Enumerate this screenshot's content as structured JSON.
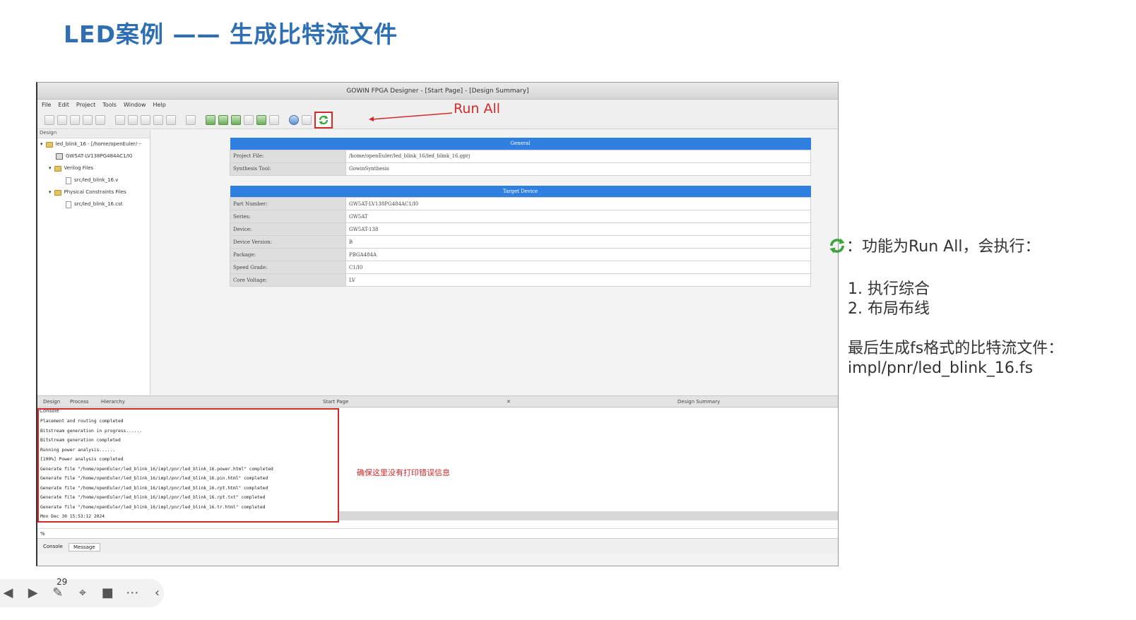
{
  "slide": {
    "title": "LED案例 —— 生成比特流文件"
  },
  "window": {
    "title": "GOWIN FPGA Designer - [Start Page] - [Design Summary]",
    "menu": [
      "File",
      "Edit",
      "Project",
      "Tools",
      "Window",
      "Help"
    ],
    "annotation_label": "Run All"
  },
  "design_panel": {
    "header": "Design",
    "tree": [
      "led_blink_16 - [/home/openEuler/···",
      "GW5AT-LV138PG484AC1/I0",
      "Verilog Files",
      "src/led_blink_16.v",
      "Physical Constraints Files",
      "src/led_blink_16.cst"
    ]
  },
  "summary": {
    "general_header": "General",
    "general_rows": [
      {
        "key": "Project File:",
        "value": "/home/openEuler/led_blink_16/led_blink_16.gprj"
      },
      {
        "key": "Synthesis Tool:",
        "value": "GowinSynthesis"
      }
    ],
    "device_header": "Target Device",
    "device_rows": [
      {
        "key": "Part Number:",
        "value": "GW5AT-LV138PG484AC1/I0"
      },
      {
        "key": "Series:",
        "value": "GW5AT"
      },
      {
        "key": "Device:",
        "value": "GW5AT-138"
      },
      {
        "key": "Device Version:",
        "value": "B"
      },
      {
        "key": "Package:",
        "value": "PBGA484A"
      },
      {
        "key": "Speed Grade:",
        "value": "C1/I0"
      },
      {
        "key": "Core Voltage:",
        "value": "LV"
      }
    ]
  },
  "tabs": {
    "design": "Design",
    "process": "Process",
    "hierarchy": "Hierarchy",
    "start_page": "Start Page",
    "close": "✕",
    "design_summary": "Design Summary"
  },
  "console": {
    "header": "Console",
    "lines": [
      "Placement and routing completed",
      "Bitstream generation in progress......",
      "Bitstream generation completed",
      "Running power analysis......",
      "[100%] Power analysis completed",
      "Generate file \"/home/openEuler/led_blink_16/impl/pnr/led_blink_16.power.html\" completed",
      "Generate file \"/home/openEuler/led_blink_16/impl/pnr/led_blink_16.pin.html\" completed",
      "Generate file \"/home/openEuler/led_blink_16/impl/pnr/led_blink_16.rpt.html\" completed",
      "Generate file \"/home/openEuler/led_blink_16/impl/pnr/led_blink_16.rpt.txt\" completed",
      "Generate file \"/home/openEuler/led_blink_16/impl/pnr/led_blink_16.tr.html\" completed",
      "Mon Dec 30 15:53:12 2024"
    ],
    "note": "确保这里没有打印错误信息",
    "prompt": "%",
    "bottom_tabs": [
      "Console",
      "Message"
    ]
  },
  "side": {
    "intro": "：功能为Run All，会执行：",
    "steps": [
      "1. 执行综合",
      "2. 布局布线"
    ],
    "final_1": "最后生成fs格式的比特流文件：",
    "final_2": "impl/pnr/led_blink_16.fs"
  },
  "player": {
    "page_number": "29"
  },
  "colors": {
    "title_blue": "#2e6fb4",
    "table_header_blue": "#2f7fe0",
    "annotation_red": "#d42a2a"
  }
}
